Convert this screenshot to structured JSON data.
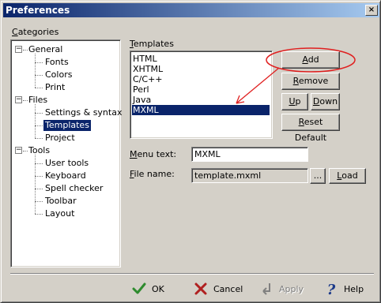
{
  "window": {
    "title": "Preferences",
    "close_glyph": "×"
  },
  "categories": {
    "label_u": "C",
    "label_rest": "ategories",
    "tree": [
      {
        "label": "General",
        "level": 0,
        "expander": "−"
      },
      {
        "label": "Fonts",
        "level": 1
      },
      {
        "label": "Colors",
        "level": 1
      },
      {
        "label": "Print",
        "level": 1
      },
      {
        "label": "Files",
        "level": 0,
        "expander": "−"
      },
      {
        "label": "Settings & syntax",
        "level": 1
      },
      {
        "label": "Templates",
        "level": 1,
        "selected": true
      },
      {
        "label": "Project",
        "level": 1
      },
      {
        "label": "Tools",
        "level": 0,
        "expander": "−"
      },
      {
        "label": "User tools",
        "level": 1
      },
      {
        "label": "Keyboard",
        "level": 1
      },
      {
        "label": "Spell checker",
        "level": 1
      },
      {
        "label": "Toolbar",
        "level": 1
      },
      {
        "label": "Layout",
        "level": 1
      }
    ]
  },
  "templates": {
    "label_u": "T",
    "label_rest": "emplates",
    "items": [
      "HTML",
      "XHTML",
      "C/C++",
      "Perl",
      "Java",
      "MXML"
    ],
    "selected_index": 5
  },
  "buttons": {
    "add_u": "A",
    "add_rest": "dd",
    "remove_u": "R",
    "remove_rest": "emove",
    "up_u": "U",
    "up_rest": "p",
    "down_u": "D",
    "down_rest": "own",
    "reset_u": "R",
    "reset_rest": "eset Default"
  },
  "fields": {
    "menu_text_u": "M",
    "menu_text_rest": "enu text:",
    "menu_text_value": "MXML",
    "file_name_u": "F",
    "file_name_rest": "ile name:",
    "file_name_value": "template.mxml",
    "browse_label": "...",
    "load_u": "L",
    "load_rest": "oad"
  },
  "footer": {
    "ok": "OK",
    "cancel": "Cancel",
    "apply": "Apply",
    "help": "Help"
  },
  "colors": {
    "accent": "#0a246a",
    "annotation": "#e02020",
    "ok_icon": "#2e8b2e",
    "cancel_icon": "#b02020",
    "help_icon": "#1c3a8a"
  },
  "icons": {
    "ok": "checkmark-icon",
    "cancel": "x-icon",
    "apply": "apply-arrow-icon",
    "help": "question-icon"
  }
}
